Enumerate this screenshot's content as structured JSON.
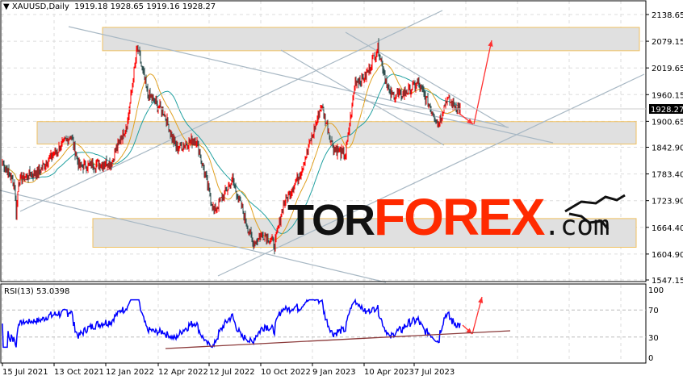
{
  "header": {
    "symbol": "XAUUSD,Daily",
    "open": "1919.18",
    "high": "1928.65",
    "low": "1919.16",
    "close": "1928.27"
  },
  "current_price_label": "1928.27",
  "rsi": {
    "label": "RSI(13) 53.0398",
    "levels": [
      "100",
      "70",
      "30",
      "0"
    ]
  },
  "logo": {
    "part1": "TOR",
    "part2": "FOREX",
    "part3": ".com"
  },
  "colors": {
    "bull": "#ff0000",
    "bear": "#2f4f4f",
    "ma_slow": "#20a0a0",
    "ma_fast": "#e0a020",
    "rsi": "#0000ff",
    "zone": "#e0e0e0",
    "zone_border": "#f0c060",
    "arrow": "#ff3030"
  },
  "chart_data": {
    "type": "line",
    "title": "XAUUSD,Daily",
    "ylim": [
      1547.15,
      2138.65
    ],
    "y_ticks": [
      "2138.65",
      "2079.15",
      "2019.65",
      "1960.15",
      "1900.65",
      "1842.90",
      "1783.40",
      "1723.90",
      "1664.40",
      "1604.90",
      "1547.15"
    ],
    "x_ticks": [
      "15 Jul 2021",
      "13 Oct 2021",
      "12 Jan 2022",
      "12 Apr 2022",
      "12 Jul 2022",
      "10 Oct 2022",
      "9 Jan 2023",
      "10 Apr 2023",
      "7 Jul 2023"
    ],
    "price_path_bar_price": [
      [
        0,
        1810
      ],
      [
        15,
        1760
      ],
      [
        17,
        1690
      ],
      [
        20,
        1770
      ],
      [
        45,
        1790
      ],
      [
        85,
        1870
      ],
      [
        95,
        1800
      ],
      [
        135,
        1810
      ],
      [
        155,
        1900
      ],
      [
        167,
        2065
      ],
      [
        180,
        1960
      ],
      [
        200,
        1920
      ],
      [
        215,
        1840
      ],
      [
        240,
        1860
      ],
      [
        262,
        1700
      ],
      [
        285,
        1770
      ],
      [
        310,
        1630
      ],
      [
        325,
        1650
      ],
      [
        337,
        1625
      ],
      [
        347,
        1710
      ],
      [
        370,
        1790
      ],
      [
        395,
        1935
      ],
      [
        410,
        1840
      ],
      [
        425,
        1825
      ],
      [
        437,
        1990
      ],
      [
        450,
        2000
      ],
      [
        465,
        2065
      ],
      [
        480,
        1960
      ],
      [
        495,
        1960
      ],
      [
        515,
        1985
      ],
      [
        540,
        1895
      ],
      [
        550,
        1950
      ],
      [
        567,
        1928
      ]
    ],
    "zones": [
      [
        2058,
        2110
      ],
      [
        1850,
        1900
      ],
      [
        1620,
        1684
      ]
    ]
  }
}
